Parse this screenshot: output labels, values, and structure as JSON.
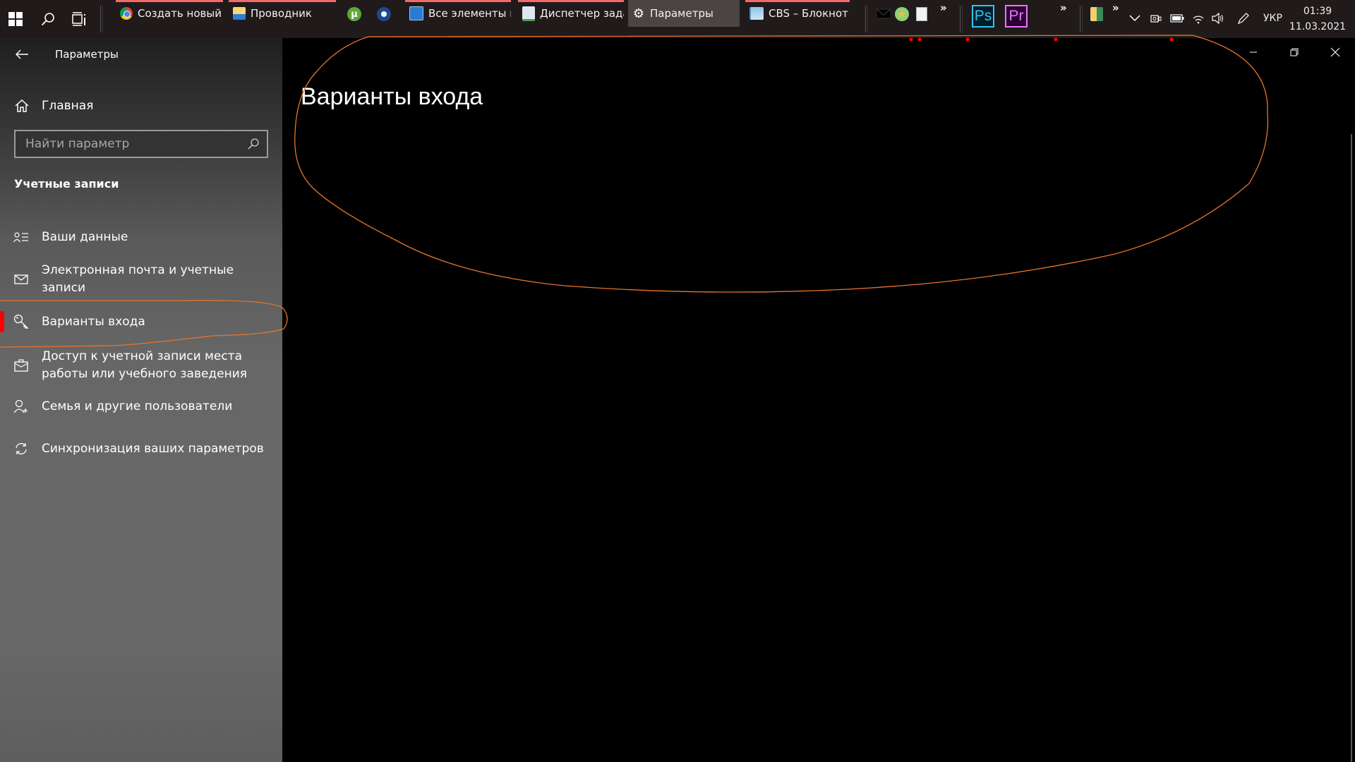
{
  "taskbar": {
    "apps": [
      {
        "label": "Создать новый ...",
        "icon": "chrome-icon",
        "running": true,
        "active": false
      },
      {
        "label": "Проводник",
        "icon": "file-explorer-icon",
        "running": true,
        "active": false
      },
      {
        "label": "Все элементы п...",
        "icon": "control-panel-icon",
        "running": true,
        "active": false
      },
      {
        "label": "Диспетчер задач",
        "icon": "task-manager-icon",
        "running": true,
        "active": false
      },
      {
        "label": "Параметры",
        "icon": "gear-icon",
        "running": true,
        "active": true
      },
      {
        "label": "CBS – Блокнот",
        "icon": "notepad-icon",
        "running": true,
        "active": false
      }
    ],
    "pinned": [
      "utorrent-icon",
      "steam-icon"
    ],
    "quick_launch": [
      "mail-icon",
      "star-icon",
      "document-icon"
    ],
    "adobe": [
      {
        "label": "Ps",
        "color": "#31c5f4"
      },
      {
        "label": "Pr",
        "color": "#ea77ff"
      }
    ],
    "overflow": "»",
    "tray": {
      "language": "УКР",
      "time": "01:39",
      "date": "11.03.2021"
    }
  },
  "window": {
    "title": "Параметры",
    "controls": {
      "minimize": "—",
      "restore": "❐",
      "close": "✕"
    }
  },
  "sidebar": {
    "home_label": "Главная",
    "search_placeholder": "Найти параметр",
    "section_title": "Учетные записи",
    "items": [
      {
        "label": "Ваши данные",
        "icon": "person-list-icon",
        "selected": false
      },
      {
        "label": "Электронная почта и учетные записи",
        "icon": "mail-icon",
        "selected": false
      },
      {
        "label": "Варианты входа",
        "icon": "key-icon",
        "selected": true
      },
      {
        "label": "Доступ к учетной записи места работы или учебного заведения",
        "icon": "briefcase-icon",
        "selected": false
      },
      {
        "label": "Семья и другие пользователи",
        "icon": "person-add-icon",
        "selected": false
      },
      {
        "label": "Синхронизация ваших параметров",
        "icon": "sync-icon",
        "selected": false
      }
    ]
  },
  "main": {
    "title": "Варианты входа"
  },
  "colors": {
    "accent_selected": "#ff0000",
    "annotation": "#e8742a",
    "taskbar_running": "#f06a6a"
  }
}
